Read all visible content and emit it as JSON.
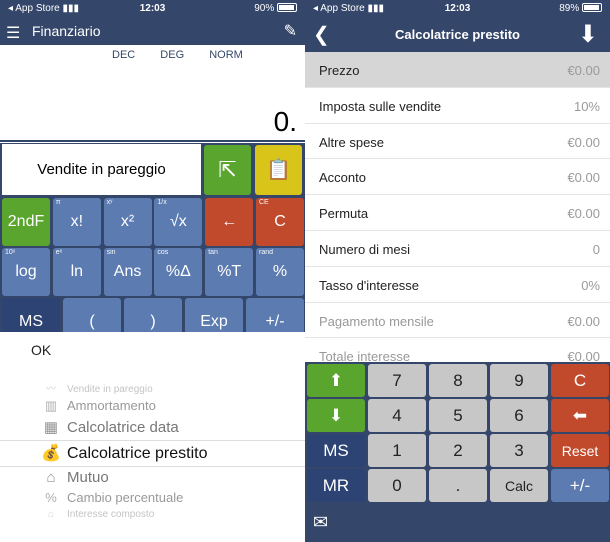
{
  "left": {
    "status": {
      "carrier": "App Store",
      "signal": "▮▮▮",
      "time": "12:03",
      "battery": "90%"
    },
    "nav": {
      "title": "Finanziario",
      "menu_icon": "☰",
      "pen_icon": "✎"
    },
    "display": {
      "modes": [
        "DEC",
        "DEG",
        "NORM"
      ],
      "value": "0."
    },
    "func_label": "Vendite in pareggio",
    "share_icon": "⇱",
    "clip_icon": "📋",
    "keys": [
      {
        "main": "2ndF",
        "sub": ""
      },
      {
        "main": "x!",
        "sub": "π"
      },
      {
        "main": "x²",
        "sub": "xʸ"
      },
      {
        "main": "√x",
        "sub": "1/x"
      },
      {
        "main": "←",
        "sub": ""
      },
      {
        "main": "C",
        "sub": "CE"
      },
      {
        "main": "log",
        "sub": "10ˣ"
      },
      {
        "main": "ln",
        "sub": "eˣ"
      },
      {
        "main": "Ans",
        "sub": "sin"
      },
      {
        "main": "%Δ",
        "sub": "cos"
      },
      {
        "main": "%T",
        "sub": "tan"
      },
      {
        "main": "%",
        "sub": "rand"
      },
      {
        "main": "MS",
        "sub": ""
      },
      {
        "main": "(",
        "sub": ""
      },
      {
        "main": ")",
        "sub": ""
      },
      {
        "main": "Exp",
        "sub": ""
      },
      {
        "main": "+/-",
        "sub": ""
      }
    ],
    "sheet": {
      "ok": "OK",
      "items": [
        {
          "label": "Vendite in pareggio",
          "icon": "〰"
        },
        {
          "label": "Ammortamento",
          "icon": "▥"
        },
        {
          "label": "Calcolatrice data",
          "icon": "▦"
        },
        {
          "label": "Calcolatrice prestito",
          "icon": "💰"
        },
        {
          "label": "Mutuo",
          "icon": "⌂"
        },
        {
          "label": "Cambio percentuale",
          "icon": "%"
        },
        {
          "label": "Interesse composto",
          "icon": "⌂"
        }
      ]
    }
  },
  "right": {
    "status": {
      "carrier": "App Store",
      "signal": "▮▮▮",
      "time": "12:03",
      "battery": "89%"
    },
    "nav": {
      "title": "Calcolatrice prestito",
      "back_icon": "❮",
      "download_icon": "⬇"
    },
    "rows": [
      {
        "label": "Prezzo",
        "value": "€0.00"
      },
      {
        "label": "Imposta sulle vendite",
        "value": "10%"
      },
      {
        "label": "Altre spese",
        "value": "€0.00"
      },
      {
        "label": "Acconto",
        "value": "€0.00"
      },
      {
        "label": "Permuta",
        "value": "€0.00"
      },
      {
        "label": "Numero di mesi",
        "value": "0"
      },
      {
        "label": "Tasso d'interesse",
        "value": "0%"
      },
      {
        "label": "Pagamento mensile",
        "value": "€0.00"
      },
      {
        "label": "Totale interesse",
        "value": "€0.00"
      }
    ],
    "keys": [
      {
        "main": "⬆"
      },
      {
        "main": "7"
      },
      {
        "main": "8"
      },
      {
        "main": "9"
      },
      {
        "main": "C"
      },
      {
        "main": "⬇"
      },
      {
        "main": "4"
      },
      {
        "main": "5"
      },
      {
        "main": "6"
      },
      {
        "main": "⬅"
      },
      {
        "main": "MS"
      },
      {
        "main": "1"
      },
      {
        "main": "2"
      },
      {
        "main": "3"
      },
      {
        "main": "Reset"
      },
      {
        "main": "MR"
      },
      {
        "main": "0"
      },
      {
        "main": "."
      },
      {
        "main": "Calc"
      },
      {
        "main": "+/-"
      }
    ],
    "mail_icon": "✉"
  }
}
